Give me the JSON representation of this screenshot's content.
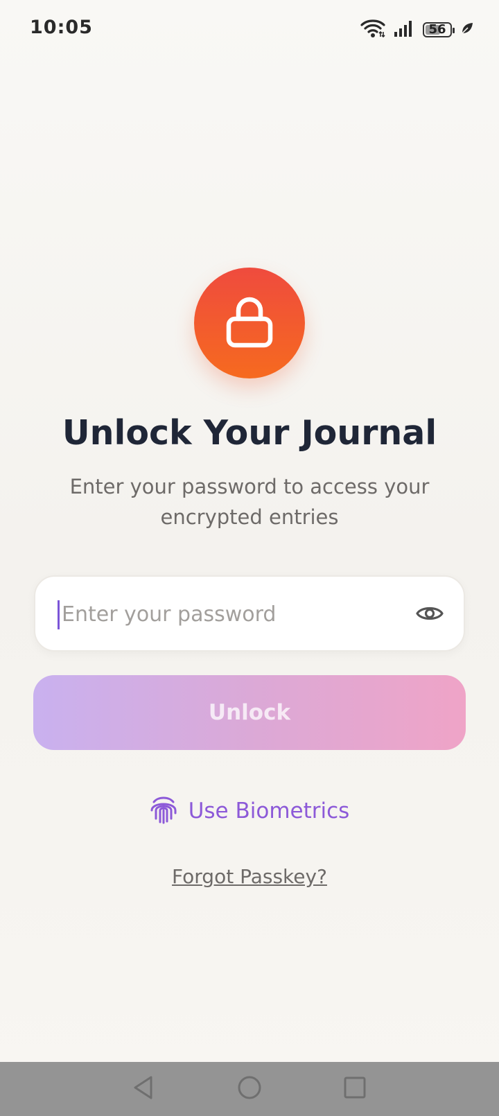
{
  "status_bar": {
    "time": "10:05",
    "battery_level": "56",
    "icons": [
      "wifi-icon",
      "signal-icon",
      "battery-icon",
      "leaf-icon"
    ]
  },
  "lock_screen": {
    "icon": "lock-icon",
    "title": "Unlock Your Journal",
    "subtitle": "Enter your password to access your encrypted entries",
    "password": {
      "value": "",
      "placeholder": "Enter your password",
      "toggle_icon": "eye-icon"
    },
    "unlock_label": "Unlock",
    "biometrics": {
      "icon": "fingerprint-icon",
      "label": "Use Biometrics"
    },
    "forgot_label": "Forgot Passkey?"
  },
  "navigation_bar": {
    "icons": [
      "back-icon",
      "home-icon",
      "recents-icon"
    ]
  },
  "colors": {
    "accent_orange": "#f05a2c",
    "accent_purple": "#8c59d8",
    "button_gradient_start": "#c9b1ef",
    "button_gradient_end": "#efa4c7",
    "title_color": "#1f2637",
    "nav_bar": "#949494"
  }
}
